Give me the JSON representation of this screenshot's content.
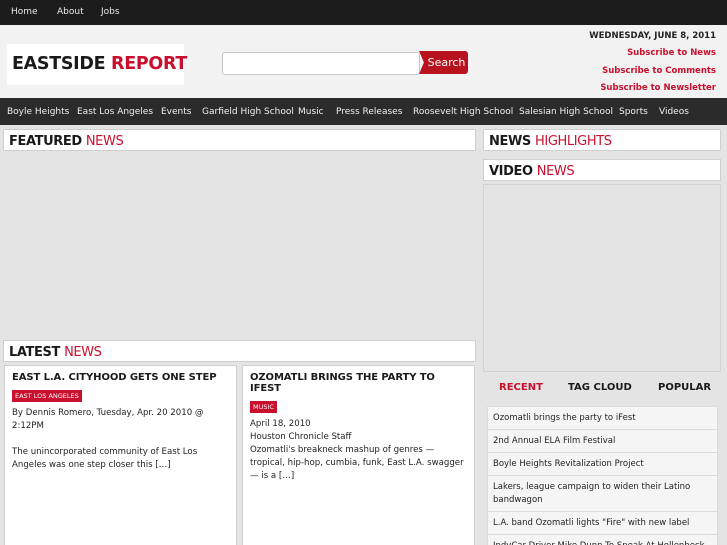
{
  "topnav": {
    "home": "Home",
    "about": "About",
    "jobs": "Jobs"
  },
  "logo": {
    "part1": "EASTSIDE",
    "part2": "REPORT"
  },
  "search": {
    "placeholder": "",
    "button": "Search"
  },
  "header": {
    "date": "WEDNESDAY, JUNE 8, 2011",
    "subscribe_news": "Subscribe to News",
    "subscribe_comments": "Subscribe to Comments",
    "subscribe_newsletter": "Subscribe to Newsletter"
  },
  "categories": [
    "Boyle Heights",
    "East Los Angeles",
    "Events",
    "Garfield High School",
    "Music",
    "Press Releases",
    "Roosevelt High School",
    "Salesian High School",
    "Sports",
    "Videos"
  ],
  "featured": {
    "a": "FEATURED",
    "b": "NEWS"
  },
  "highlights": {
    "a": "NEWS",
    "b": "HIGHLIGHTS"
  },
  "video": {
    "a": "VIDEO",
    "b": "NEWS"
  },
  "latest": {
    "a": "LATEST",
    "b": "NEWS"
  },
  "cards": [
    {
      "title": "EAST L.A. CITYHOOD GETS ONE STEP",
      "badge": "EAST LOS ANGELES",
      "meta": "By Dennis Romero, Tuesday, Apr. 20 2010 @ 2:12PM",
      "excerpt": "The unincorporated community of East Los Angeles was one step closer this […]"
    },
    {
      "title": "OZOMATLI BRINGS THE PARTY TO IFEST",
      "badge": "MUSIC",
      "meta": "April 18, 2010",
      "meta2": "Houston Chronicle Staff",
      "excerpt": "Ozomatli's breakneck mashup of genres — tropical, hip-hop, cumbia, funk, East L.A. swagger — is a […]"
    }
  ],
  "tabs": {
    "recent": "RECENT",
    "tagcloud": "TAG CLOUD",
    "popular": "POPULAR"
  },
  "recent_items": [
    "Ozomatli brings the party to iFest",
    "2nd Annual ELA Film Festival",
    "Boyle Heights Revitalization Project",
    "Lakers, league campaign to widen their Latino bandwagon",
    "L.A. band Ozomatli lights \"Fire\" with new label",
    "IndyCar Driver Mike Dunn To Speak At Hollenbeck"
  ],
  "colors": {
    "accent": "#c8102e",
    "topbar": "#1c1c1c",
    "catbar": "#2b2b2b",
    "background": "#e4e4e4"
  }
}
